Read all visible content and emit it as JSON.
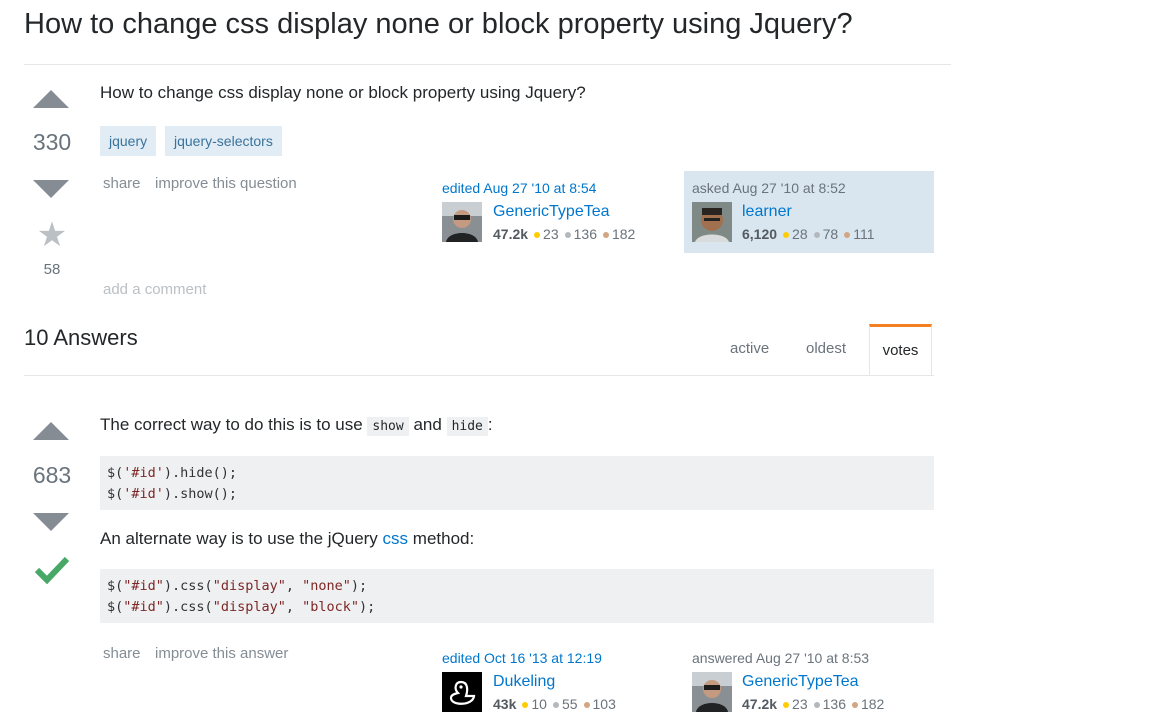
{
  "page_title": "How to change css display none or block property using Jquery?",
  "question": {
    "votes": "330",
    "favorites": "58",
    "body": "How to change css display none or block property using Jquery?",
    "tags": [
      "jquery",
      "jquery-selectors"
    ],
    "menu": {
      "share": "share",
      "improve": "improve this question"
    },
    "editor": {
      "action": "edited Aug 27 '10 at 8:54",
      "name": "GenericTypeTea",
      "rep": "47.2k",
      "gold": "23",
      "silver": "136",
      "bronze": "182"
    },
    "asker": {
      "action": "asked Aug 27 '10 at 8:52",
      "name": "learner",
      "rep": "6,120",
      "gold": "28",
      "silver": "78",
      "bronze": "111"
    },
    "add_comment": "add a comment"
  },
  "answers_header": {
    "count_label": "10 Answers",
    "tabs": {
      "active": "active",
      "oldest": "oldest",
      "votes": "votes"
    }
  },
  "answer": {
    "votes": "683",
    "intro": {
      "before": "The correct way to do this is to use",
      "code1": "show",
      "mid": "and",
      "code2": "hide",
      "after": ":"
    },
    "code1": {
      "line1": {
        "pre": "$(",
        "str": "'#id'",
        "post": ").hide();"
      },
      "line2": {
        "pre": "$(",
        "str": "'#id'",
        "post": ").show();"
      }
    },
    "alt": {
      "before": "An alternate way is to use the jQuery",
      "link": "css",
      "after": "method:"
    },
    "code2": {
      "line1": {
        "a": "$(",
        "s1": "\"#id\"",
        "b": ").css(",
        "s2": "\"display\"",
        "c": ", ",
        "s3": "\"none\"",
        "d": ");"
      },
      "line2": {
        "a": "$(",
        "s1": "\"#id\"",
        "b": ").css(",
        "s2": "\"display\"",
        "c": ", ",
        "s3": "\"block\"",
        "d": ");"
      }
    },
    "menu": {
      "share": "share",
      "improve": "improve this answer"
    },
    "editor": {
      "action": "edited Oct 16 '13 at 12:19",
      "name": "Dukeling",
      "rep": "43k",
      "gold": "10",
      "silver": "55",
      "bronze": "103"
    },
    "answerer": {
      "action": "answered Aug 27 '10 at 8:53",
      "name": "GenericTypeTea",
      "rep": "47.2k",
      "gold": "23",
      "silver": "136",
      "bronze": "182"
    }
  }
}
